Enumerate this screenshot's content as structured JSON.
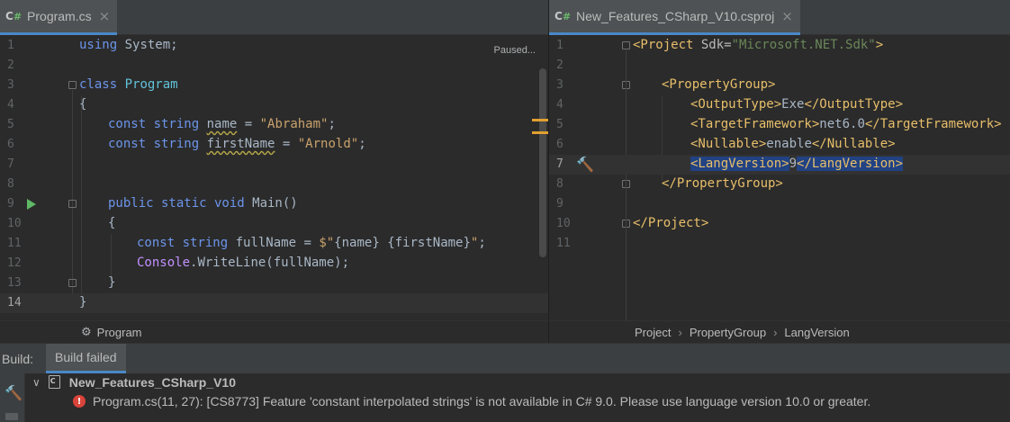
{
  "left_editor": {
    "tab": {
      "icon": "csharp-file-icon",
      "icon_c": "C",
      "icon_s": "#",
      "label": "Program.cs",
      "close": "×"
    },
    "status_text": "Paused...",
    "line_numbers": [
      "1",
      "2",
      "3",
      "4",
      "5",
      "6",
      "7",
      "8",
      "9",
      "10",
      "11",
      "12",
      "13",
      "14"
    ],
    "tokens": {
      "l1_kw": "using",
      "l1_rest": " System;",
      "l3_kw": "class",
      "l3_cls": "Program",
      "l4": "{",
      "l5_kw": "const string",
      "l5_id": "name",
      "l5_eq": " = ",
      "l5_str": "\"Abraham\"",
      "l5_end": ";",
      "l6_kw": "const string",
      "l6_id": "firstName",
      "l6_eq": " = ",
      "l6_str": "\"Arnold\"",
      "l6_end": ";",
      "l9_kw": "public static void",
      "l9_rest": " Main()",
      "l10": "{",
      "l11_kw": "const string",
      "l11_id": " fullName = ",
      "l11_str1": "$\"",
      "l11_i1": "{name}",
      "l11_sp": " ",
      "l11_i2": "{firstName}",
      "l11_str2": "\"",
      "l11_end": ";",
      "l12_ty": "Console",
      "l12_rest": ".WriteLine(fullName);",
      "l13": "}",
      "l14": "}"
    },
    "breadcrumb": {
      "icon": "class-structure-icon",
      "label": "Program"
    }
  },
  "right_editor": {
    "tab": {
      "icon": "csharp-project-icon",
      "icon_c": "C",
      "icon_s": "#",
      "label": "New_Features_CSharp_V10.csproj",
      "close": "×"
    },
    "line_numbers": [
      "1",
      "2",
      "3",
      "4",
      "5",
      "6",
      "7",
      "8",
      "9",
      "10",
      "11"
    ],
    "tokens": {
      "l1_tag": "<Project",
      "l1_attr": " Sdk=",
      "l1_val": "\"Microsoft.NET.Sdk\"",
      "l1_close": ">",
      "l3": "<PropertyGroup>",
      "l4_open": "<OutputType>",
      "l4_text": "Exe",
      "l4_close": "</OutputType>",
      "l5_open": "<TargetFramework>",
      "l5_text": "net6.0",
      "l5_close": "</TargetFramework>",
      "l6_open": "<Nullable>",
      "l6_text": "enable",
      "l6_close": "</Nullable>",
      "l7_open": "<LangVersion>",
      "l7_text": "9",
      "l7_close": "</LangVersion>",
      "l8": "</PropertyGroup>",
      "l10": "</Project>"
    },
    "breadcrumb": [
      "Project",
      "PropertyGroup",
      "LangVersion"
    ],
    "breadcrumb_sep": "›"
  },
  "build_panel": {
    "title": "Build:",
    "tab_label": "Build failed",
    "project_name": "New_Features_CSharp_V10",
    "error_message": "Program.cs(11, 27): [CS8773] Feature 'constant interpolated strings' is not available in C# 9.0. Please use language version 10.0 or greater."
  },
  "colors": {
    "accent": "#4a88c7",
    "error": "#d9443a",
    "run": "#5fb865",
    "warning": "#e0a030"
  }
}
